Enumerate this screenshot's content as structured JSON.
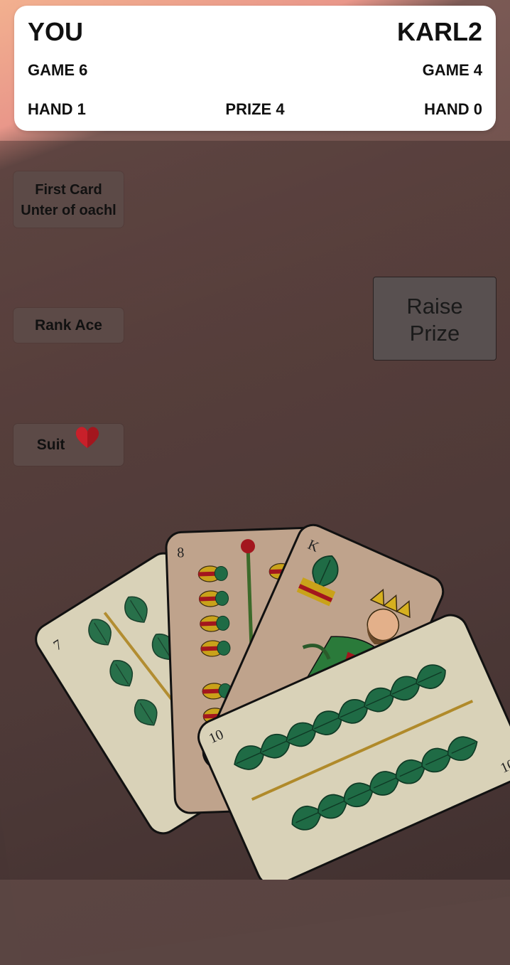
{
  "scoreboard": {
    "player_name": "YOU",
    "opponent_name": "KARL2",
    "player_game": "GAME 6",
    "opponent_game": "GAME 4",
    "player_hand": "HAND 1",
    "prize": "PRIZE 4",
    "opponent_hand": "HAND 0"
  },
  "info": {
    "first_card_title": "First Card",
    "first_card_value": "Unter of oachl",
    "rank": "Rank Ace",
    "suit_label": "Suit",
    "suit_icon": "heart-icon"
  },
  "actions": {
    "raise_line1": "Raise",
    "raise_line2": "Prize"
  },
  "hand": {
    "cards": [
      {
        "rank": "7",
        "suit": "leaves"
      },
      {
        "rank": "8",
        "suit": "bells"
      },
      {
        "rank": "K",
        "suit": "leaves"
      },
      {
        "rank": "10",
        "suit": "leaves"
      }
    ]
  },
  "colors": {
    "heart": "#c8202a",
    "leaf": "#1f6b45",
    "card_face": "#d9d2b8"
  }
}
